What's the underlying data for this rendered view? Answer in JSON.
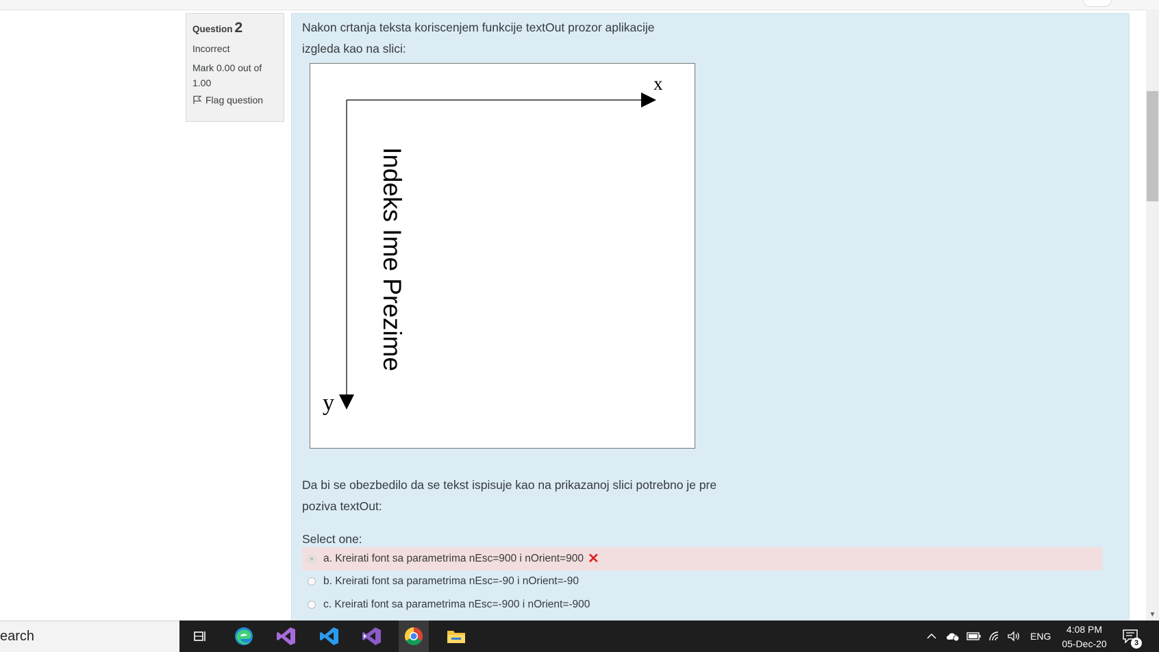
{
  "question": {
    "label": "Question",
    "number": "2",
    "state": "Incorrect",
    "grade": "Mark 0.00 out of 1.00",
    "flag_label": "Flag question",
    "text_part1": "Nakon crtanja teksta koriscenjem funkcije textOut prozor aplikacije izgleda kao na slici:",
    "figure": {
      "x_label": "x",
      "y_label": "y",
      "rotated_text": "Indeks Ime Prezime"
    },
    "text_part2": "Da bi se obezbedilo da se tekst ispisuje kao na prikazanoj slici potrebno je pre poziva textOut:",
    "prompt": "Select one:",
    "options": [
      {
        "label": "a. Kreirati font sa parametrima nEsc=900 i nOrient=900",
        "selected": true,
        "result": "incorrect"
      },
      {
        "label": "b. Kreirati font sa parametrima nEsc=-90 i nOrient=-90",
        "selected": false
      },
      {
        "label": "c. Kreirati font sa parametrima nEsc=-900 i nOrient=-900",
        "selected": false
      }
    ]
  },
  "taskbar": {
    "search_text": "earch",
    "apps": [
      "task-view",
      "edge",
      "visual-studio",
      "vscode",
      "visual-studio-alt",
      "chrome",
      "file-explorer"
    ],
    "language": "ENG",
    "time": "4:08 PM",
    "date": "05-Dec-20",
    "notification_count": "3"
  },
  "colors": {
    "content_bg": "#dbecf5",
    "info_bg": "#f1f1f1",
    "incorrect_bg": "#f2dede",
    "incorrect_mark": "#e02424",
    "taskbar_bg": "#1e1e1e"
  }
}
